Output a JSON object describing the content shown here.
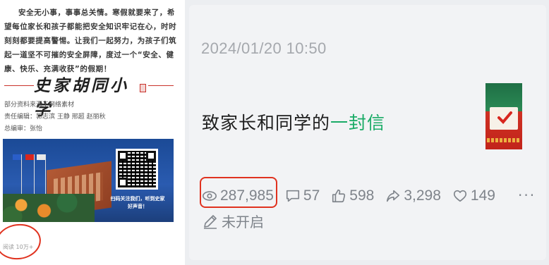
{
  "article": {
    "body": "安全无小事，事事总关情。寒假就要来了，希望每位家长和孩子都能把安全知识牢记在心，时时刻刻都要提高警惕。让我们一起努力，为孩子们筑起一道坚不可摧的安全屏障，度过一个“安全、健康、快乐、充满收获”的假期！",
    "school_name": "史家胡同小学",
    "credits": [
      "部分资料来源于网络素材",
      "责任编辑：郭志滨 王静 邢超 赵丽秋",
      "总编审：张怡"
    ],
    "banner_caption": "扫码关注我们，听到史家好声音！",
    "read_count": "阅读 10万+"
  },
  "post": {
    "timestamp": "2024/01/20 10:50",
    "title_main": "致家长和同学的",
    "title_accent": "一封信",
    "stats": {
      "views": "287,985",
      "comments": "57",
      "likes": "598",
      "shares": "3,298",
      "favorites": "149"
    },
    "more_label": "···",
    "comment_status": "未开启"
  },
  "colors": {
    "accent_green": "#1aab66",
    "highlight_red": "#e0321f",
    "stat_gray": "#7f848b"
  },
  "icons": [
    "eye-icon",
    "comment-icon",
    "thumbs-up-icon",
    "share-icon",
    "heart-icon",
    "more-icon",
    "pen-icon"
  ]
}
